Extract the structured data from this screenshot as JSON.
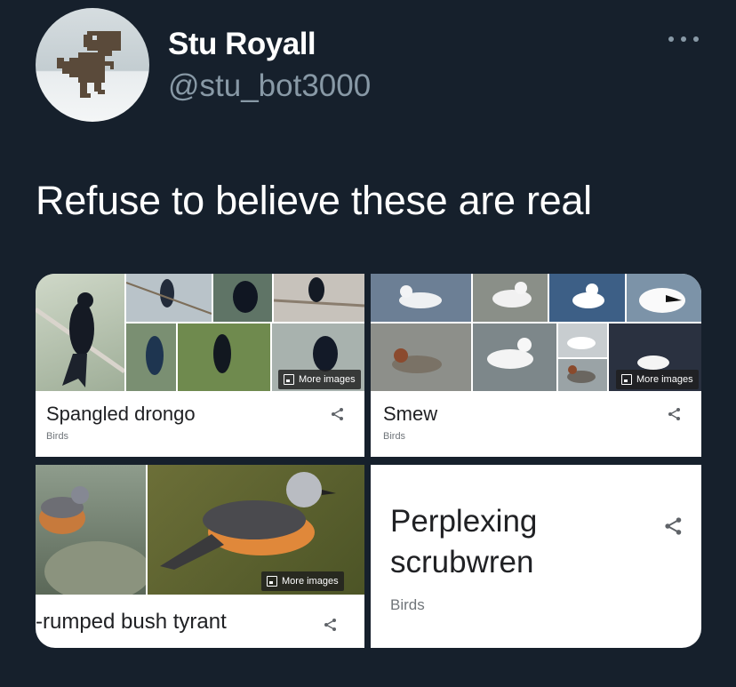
{
  "tweet": {
    "display_name": "Stu Royall",
    "handle": "@stu_bot3000",
    "text": "Refuse to believe these are real"
  },
  "icons": {
    "avatar": "dinosaur-icon",
    "more": "more-icon",
    "share": "share-icon",
    "image": "image-icon"
  },
  "cards": [
    {
      "title": "Spangled drongo",
      "category": "Birds",
      "more_images": "More images"
    },
    {
      "title": "Smew",
      "category": "Birds",
      "more_images": "More images"
    },
    {
      "title": "-rumped bush tyrant",
      "more_images": "More images"
    },
    {
      "title_line1": "Perplexing",
      "title_line2": "scrubwren",
      "category": "Birds"
    }
  ],
  "colors": {
    "background": "#16202c",
    "text_primary": "#ffffff",
    "text_secondary": "#8899a6",
    "card_bg": "#ffffff"
  }
}
